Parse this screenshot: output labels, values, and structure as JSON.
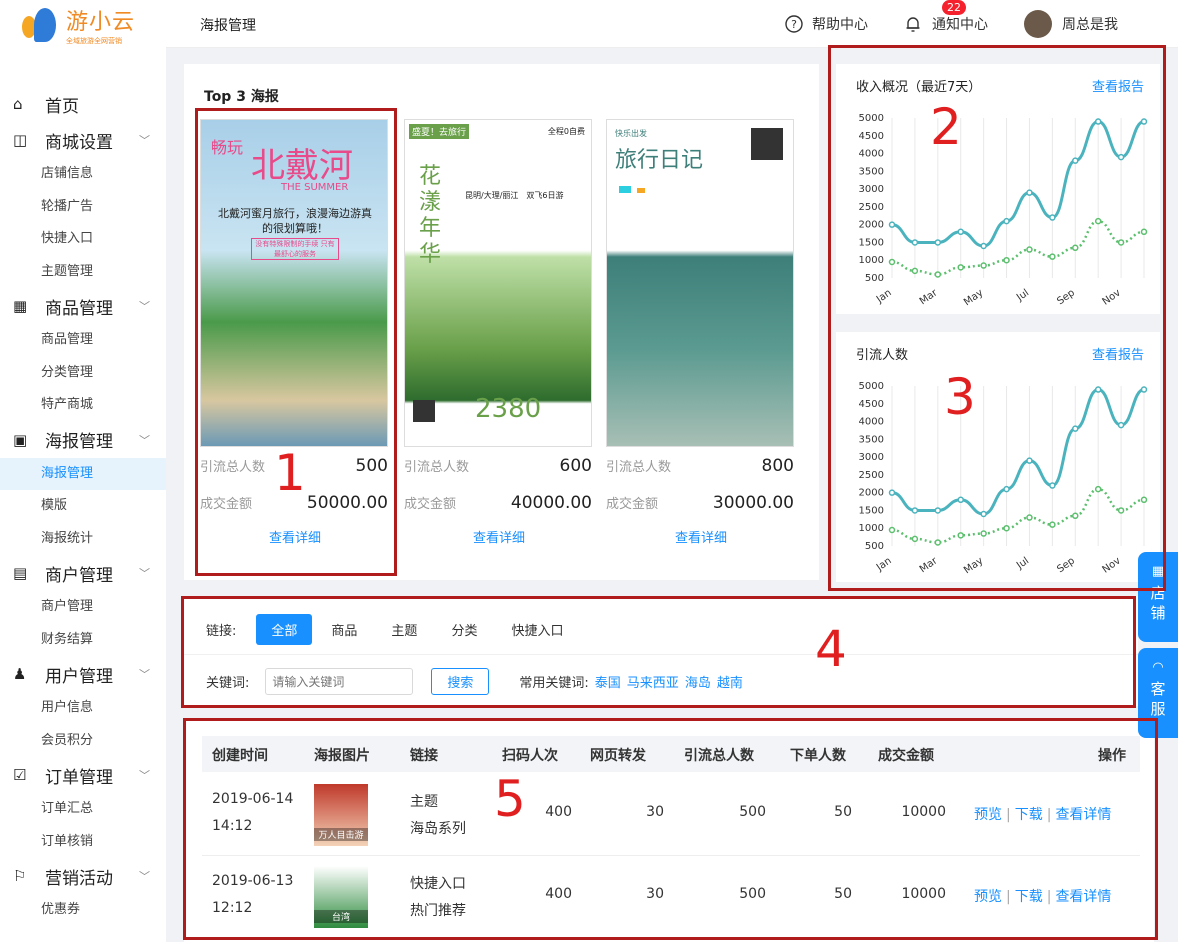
{
  "logo": {
    "title": "游小云",
    "subtitle": "全域旅游全网营销"
  },
  "sidebar": {
    "groups": [
      {
        "label": "首页",
        "icon": "home-icon",
        "items": []
      },
      {
        "label": "商城设置",
        "icon": "shop-icon",
        "items": [
          "店铺信息",
          "轮播广告",
          "快捷入口",
          "主题管理"
        ]
      },
      {
        "label": "商品管理",
        "icon": "grid-icon",
        "items": [
          "商品管理",
          "分类管理",
          "特产商城"
        ]
      },
      {
        "label": "海报管理",
        "icon": "image-icon",
        "items": [
          "海报管理",
          "模版",
          "海报统计"
        ]
      },
      {
        "label": "商户管理",
        "icon": "store-icon",
        "items": [
          "商户管理",
          "财务结算"
        ]
      },
      {
        "label": "用户管理",
        "icon": "users-icon",
        "items": [
          "用户信息",
          "会员积分"
        ]
      },
      {
        "label": "订单管理",
        "icon": "checkbox-icon",
        "items": [
          "订单汇总",
          "订单核销"
        ]
      },
      {
        "label": "营销活动",
        "icon": "flag-icon",
        "items": [
          "优惠券"
        ]
      }
    ],
    "active_item": "海报管理"
  },
  "topbar": {
    "title": "海报管理",
    "help": "帮助中心",
    "notify": "通知中心",
    "notify_count": "22",
    "user": "周总是我"
  },
  "top3": {
    "title": "Top 3 海报",
    "posters": [
      {
        "traffic_label": "引流总人数",
        "traffic": "500",
        "amount_label": "成交金额",
        "amount": "50000.00",
        "link": "查看详细",
        "headline": "北戴河",
        "tag": "畅玩",
        "sub": "THE SUMMER",
        "desc": "北戴河蜜月旅行，浪漫海边游真的很划算哦！",
        "note": "没有特殊限制的手续 只有最舒心的服务",
        "colors": [
          "#a8cfe8",
          "#4a9a4a",
          "#d8c7a0"
        ]
      },
      {
        "traffic_label": "引流总人数",
        "traffic": "600",
        "amount_label": "成交金额",
        "amount": "40000.00",
        "link": "查看详细",
        "headline": "花漾年华",
        "brand": "盛夏！去旅行",
        "tag2": "全程0自费",
        "route": "昆明/大理/丽江　双飞6日游",
        "price": "2380",
        "colors": [
          "#ffffff",
          "#6aa04a",
          "#2e6c2e"
        ]
      },
      {
        "traffic_label": "引流总人数",
        "traffic": "800",
        "amount_label": "成交金额",
        "amount": "30000.00",
        "link": "查看详细",
        "headline": "旅行日记",
        "brand": "快乐出发",
        "colors": [
          "#ffffff",
          "#3e7f7a",
          "#a8bfb5"
        ]
      }
    ]
  },
  "charts": [
    {
      "title": "收入概况（最近7天）",
      "link": "查看报告"
    },
    {
      "title": "引流人数",
      "link": "查看报告"
    }
  ],
  "chart_data": [
    {
      "type": "line",
      "title": "收入概况（最近7天）",
      "x": [
        "Jan",
        "Feb",
        "Mar",
        "Apr",
        "May",
        "Jun",
        "Jul",
        "Aug",
        "Sep",
        "Oct",
        "Nov",
        "Dec"
      ],
      "xticks": [
        "Jan",
        "Mar",
        "May",
        "Jul",
        "Sep",
        "Nov"
      ],
      "yticks": [
        500,
        1000,
        1500,
        2000,
        2500,
        3000,
        3500,
        4000,
        4500,
        5000
      ],
      "ylim": [
        500,
        5000
      ],
      "series": [
        {
          "color": "#4ab3bd",
          "style": "solid",
          "values": [
            2000,
            1500,
            1500,
            1800,
            1400,
            2100,
            2900,
            2200,
            3800,
            4900,
            3900,
            4900
          ]
        },
        {
          "color": "#5cbf6e",
          "style": "dotted",
          "values": [
            950,
            700,
            600,
            800,
            850,
            1000,
            1300,
            1100,
            1350,
            2100,
            1500,
            1800
          ]
        }
      ]
    },
    {
      "type": "line",
      "title": "引流人数",
      "x": [
        "Jan",
        "Feb",
        "Mar",
        "Apr",
        "May",
        "Jun",
        "Jul",
        "Aug",
        "Sep",
        "Oct",
        "Nov",
        "Dec"
      ],
      "xticks": [
        "Jan",
        "Mar",
        "May",
        "Jul",
        "Sep",
        "Nov"
      ],
      "yticks": [
        500,
        1000,
        1500,
        2000,
        2500,
        3000,
        3500,
        4000,
        4500,
        5000
      ],
      "ylim": [
        500,
        5000
      ],
      "series": [
        {
          "color": "#4ab3bd",
          "style": "solid",
          "values": [
            2000,
            1500,
            1500,
            1800,
            1400,
            2100,
            2900,
            2200,
            3800,
            4900,
            3900,
            4900
          ]
        },
        {
          "color": "#5cbf6e",
          "style": "dotted",
          "values": [
            950,
            700,
            600,
            800,
            850,
            1000,
            1300,
            1100,
            1350,
            2100,
            1500,
            1800
          ]
        }
      ]
    }
  ],
  "filter": {
    "link_label": "链接:",
    "tabs": [
      "全部",
      "商品",
      "主题",
      "分类",
      "快捷入口"
    ],
    "keyword_label": "关键词:",
    "placeholder": "请输入关键词",
    "search": "搜索",
    "common_label": "常用关键词:",
    "keywords": [
      "泰国",
      "马来西亚",
      "海岛",
      "越南"
    ]
  },
  "table": {
    "headers": [
      "创建时间",
      "海报图片",
      "链接",
      "扫码人次",
      "网页转发",
      "引流总人数",
      "下单人数",
      "成交金额",
      "操作"
    ],
    "rows": [
      {
        "date": "2019-06-14",
        "time": "14:12",
        "link1": "主题",
        "link2": "海岛系列",
        "scan": "400",
        "share": "30",
        "traffic": "500",
        "orders": "50",
        "amount": "10000",
        "ops": [
          "预览",
          "下载",
          "查看详情"
        ],
        "thumb_colors": [
          "#c0392b",
          "#f3d3b8"
        ],
        "thumb_text": "万人目击游"
      },
      {
        "date": "2019-06-13",
        "time": "12:12",
        "link1": "快捷入口",
        "link2": "热门推荐",
        "scan": "400",
        "share": "30",
        "traffic": "500",
        "orders": "50",
        "amount": "10000",
        "ops": [
          "预览",
          "下载",
          "查看详情"
        ],
        "thumb_colors": [
          "#ffffff",
          "#2e8b3e"
        ],
        "thumb_text": "台湾"
      }
    ]
  },
  "float_buttons": [
    {
      "label": "店铺",
      "icon": "store-grid-icon"
    },
    {
      "label": "客服",
      "icon": "headset-icon"
    }
  ],
  "annotations": [
    "1",
    "2",
    "3",
    "4",
    "5"
  ]
}
